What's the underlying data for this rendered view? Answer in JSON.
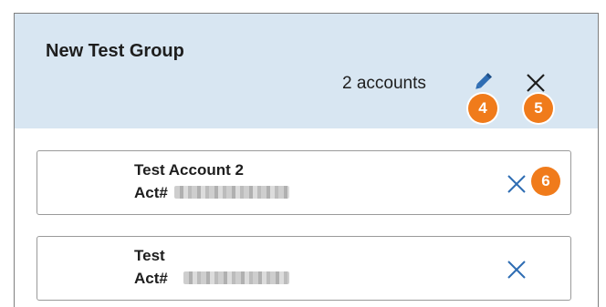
{
  "group": {
    "title": "New Test Group",
    "accounts_count": "2 accounts"
  },
  "badges": {
    "edit": "4",
    "close": "5",
    "remove": "6"
  },
  "accounts": [
    {
      "name": "Test Account 2",
      "number_label": "Act#"
    },
    {
      "name": "Test",
      "number_label": "Act#"
    }
  ],
  "colors": {
    "header_bg": "#d8e6f2",
    "badge": "#f07b1b",
    "accent_icon": "#2f6db3"
  },
  "icons": {
    "edit": "pencil-icon",
    "close": "close-icon",
    "remove": "remove-x-icon"
  }
}
